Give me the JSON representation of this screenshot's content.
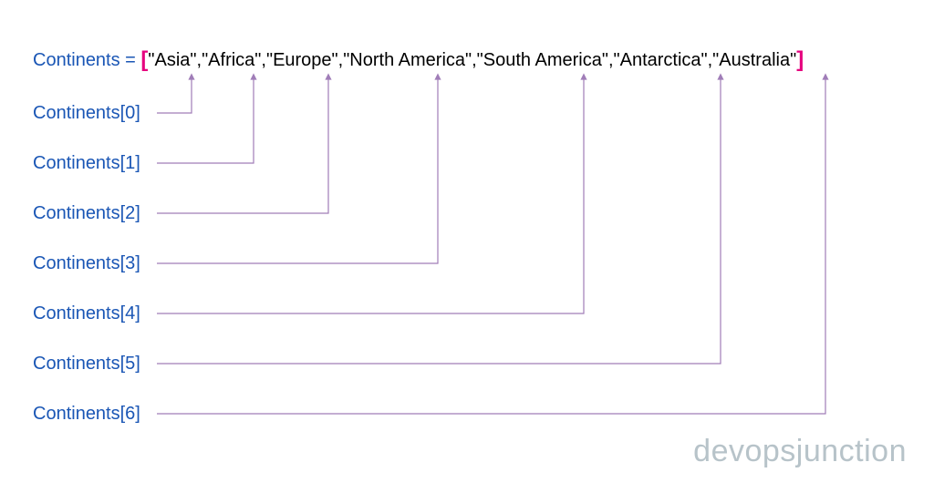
{
  "declaration": {
    "varname": "Continents",
    "equals": " = ",
    "open_bracket": "[",
    "content": "\"Asia\",\"Africa\",\"Europe\",\"North America\",\"South America\",\"Antarctica\",\"Australia\"",
    "close_bracket": "]"
  },
  "array_values": [
    "Asia",
    "Africa",
    "Europe",
    "North America",
    "South America",
    "Antarctica",
    "Australia"
  ],
  "index_labels": [
    "Continents[0]",
    "Continents[1]",
    "Continents[2]",
    "Continents[3]",
    "Continents[4]",
    "Continents[5]",
    "Continents[6]"
  ],
  "watermark": "devopsjunction",
  "colors": {
    "varname": "#1a56b5",
    "bracket": "#e6007e",
    "arrow": "#a07db8",
    "watermark": "#b7c3c9"
  }
}
